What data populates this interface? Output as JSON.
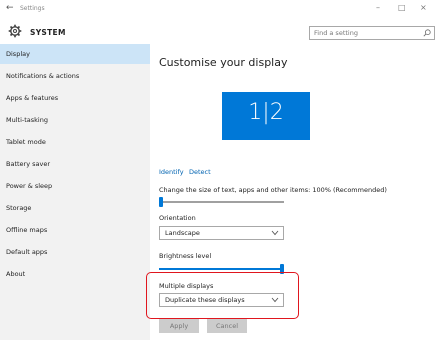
{
  "titlebar": {
    "back_glyph": "←",
    "title": "Settings",
    "minimize": "–",
    "maximize": "□",
    "close": "×"
  },
  "header": {
    "title": "SYSTEM",
    "search_placeholder": "Find a setting",
    "icon": "gear-icon"
  },
  "sidebar": {
    "items": [
      {
        "label": "Display",
        "active": true
      },
      {
        "label": "Notifications & actions"
      },
      {
        "label": "Apps & features"
      },
      {
        "label": "Multi-tasking"
      },
      {
        "label": "Tablet mode"
      },
      {
        "label": "Battery saver"
      },
      {
        "label": "Power & sleep"
      },
      {
        "label": "Storage"
      },
      {
        "label": "Offline maps"
      },
      {
        "label": "Default apps"
      },
      {
        "label": "About"
      }
    ]
  },
  "main": {
    "title": "Customise your display",
    "monitor_label": "1|2",
    "identify": "Identify",
    "detect": "Detect",
    "scale_label": "Change the size of text, apps and other items: 100% (Recommended)",
    "scale_value_percent": 0,
    "orientation_label": "Orientation",
    "orientation_value": "Landscape",
    "brightness_label": "Brightness level",
    "brightness_value_percent": 100,
    "multiple_displays_label": "Multiple displays",
    "multiple_displays_value": "Duplicate these displays",
    "apply": "Apply",
    "cancel": "Cancel"
  },
  "colors": {
    "accent": "#0078d7",
    "sidebar_bg": "#f2f2f2",
    "active_item": "#cce4f7",
    "highlight": "#e0161e",
    "link": "#0063b1"
  }
}
